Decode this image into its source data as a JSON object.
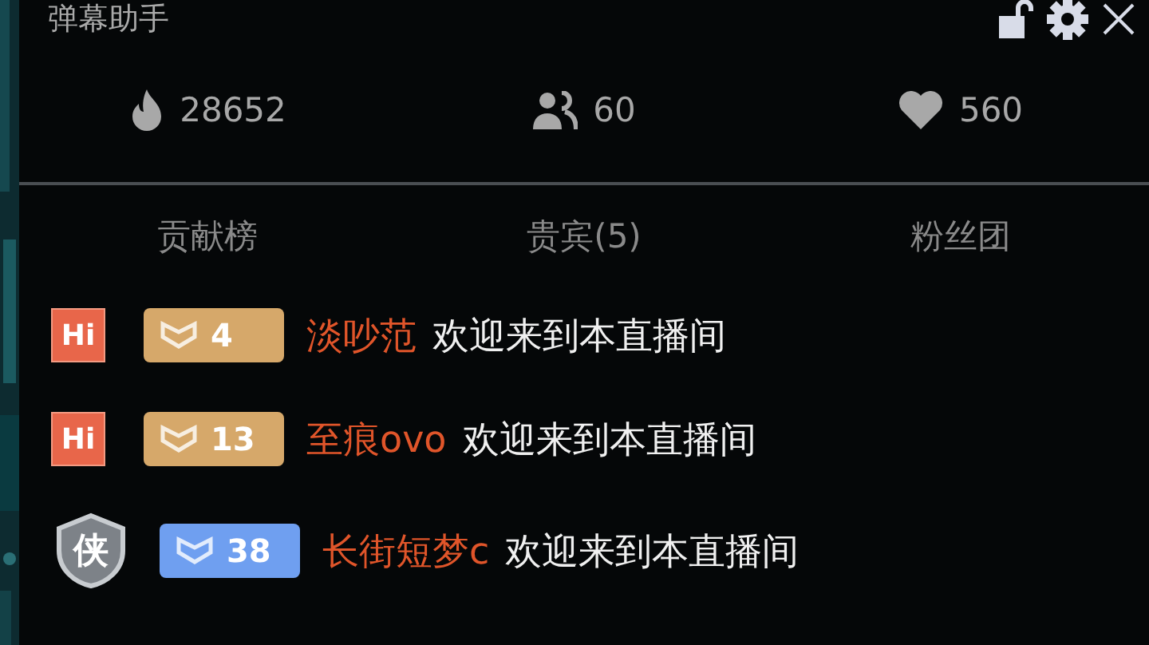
{
  "window": {
    "title": "弹幕助手"
  },
  "stats": [
    {
      "kind": "fire",
      "value": "28652"
    },
    {
      "kind": "people",
      "value": "60"
    },
    {
      "kind": "heart",
      "value": "560"
    }
  ],
  "tabs": [
    {
      "label": "贡献榜",
      "selected": false
    },
    {
      "label": "贵宾(5)",
      "selected": false
    },
    {
      "label": "粉丝团",
      "selected": false
    }
  ],
  "messages": [
    {
      "badge": {
        "kind": "hi",
        "text": "Hi"
      },
      "level": {
        "text": "4",
        "color": "#d6a86a"
      },
      "user": "淡吵范",
      "text": "欢迎来到本直播间"
    },
    {
      "badge": {
        "kind": "hi",
        "text": "Hi"
      },
      "level": {
        "text": "13",
        "color": "#d6a86a"
      },
      "user": "至痕ovo",
      "text": "欢迎来到本直播间"
    },
    {
      "badge": {
        "kind": "shield",
        "text": "侠"
      },
      "level": {
        "text": "38",
        "color": "#6f9ff0"
      },
      "user": "长街短梦c",
      "text": "欢迎来到本直播间"
    }
  ]
}
